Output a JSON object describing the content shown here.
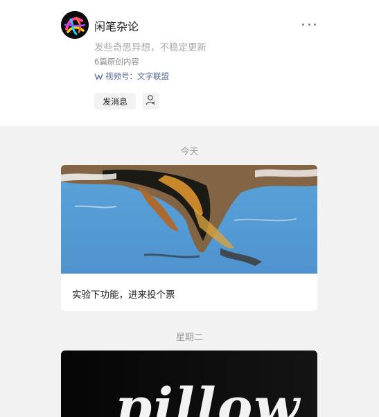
{
  "profile": {
    "name": "闲笔杂论",
    "description": "发些奇思异想，不稳定更新",
    "original_count": "6篇原创内容",
    "video_channel": "视频号：文字联盟",
    "message_button": "发消息"
  },
  "feed": {
    "groups": [
      {
        "date": "今天",
        "article_title": "实验下功能，进来投个票"
      },
      {
        "date": "星期二",
        "cover_text": "pillow"
      }
    ]
  },
  "colors": {
    "link": "#576b95",
    "feed_background": "#f2f2f2"
  },
  "icons": [
    "more-icon",
    "video-channel-icon",
    "user-profile-icon"
  ]
}
